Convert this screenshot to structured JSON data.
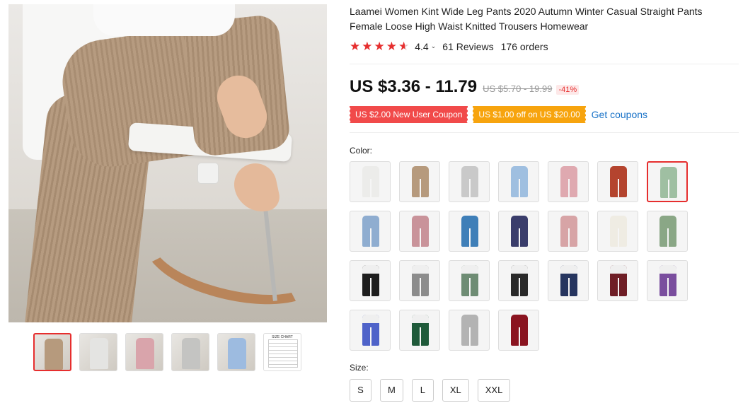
{
  "product": {
    "title": "Laamei Women Kint Wide Leg Pants 2020 Autumn Winter Casual Straight Pants Female Loose High Waist Knitted Trousers Homewear",
    "rating": "4.4",
    "rating_chevron": "⌄",
    "reviews": "61 Reviews",
    "orders": "176 orders"
  },
  "price": {
    "current": "US $3.36 - 11.79",
    "original": "US $5.70 - 19.99",
    "discount": "-41%"
  },
  "coupons": {
    "new_user": "US $2.00 New User Coupon",
    "store": "US $1.00 off on US $20.00",
    "get": "Get coupons"
  },
  "color_label": "Color:",
  "size_label": "Size:",
  "colors": [
    {
      "name": "white",
      "color": "#ececea"
    },
    {
      "name": "khaki",
      "color": "#b69a7d"
    },
    {
      "name": "light-gray",
      "color": "#c9c9c9"
    },
    {
      "name": "light-blue",
      "color": "#9fbfe0"
    },
    {
      "name": "pink",
      "color": "#dfa9b0"
    },
    {
      "name": "rust-red",
      "color": "#b4442e"
    },
    {
      "name": "green-print",
      "color": "#9fbfa2",
      "selected": true
    },
    {
      "name": "denim-blue",
      "color": "#8fadd0"
    },
    {
      "name": "dusty-pink",
      "color": "#c9939a"
    },
    {
      "name": "blue-print",
      "color": "#3f7fb8"
    },
    {
      "name": "navy-print",
      "color": "#3a3d6b"
    },
    {
      "name": "pink-print",
      "color": "#d7a4a6"
    },
    {
      "name": "cream",
      "color": "#efece3"
    },
    {
      "name": "sage-green",
      "color": "#8aa786"
    },
    {
      "name": "black",
      "color": "#1e1e1e"
    },
    {
      "name": "gray",
      "color": "#8c8c8c"
    },
    {
      "name": "green",
      "color": "#6e8c74"
    },
    {
      "name": "black-2",
      "color": "#2a2a2a"
    },
    {
      "name": "navy",
      "color": "#26355f"
    },
    {
      "name": "burgundy",
      "color": "#6f1e26"
    },
    {
      "name": "purple",
      "color": "#7a4e9e"
    },
    {
      "name": "royal-blue",
      "color": "#4f63c9"
    },
    {
      "name": "dark-green",
      "color": "#1f5a3a"
    },
    {
      "name": "silver-gray",
      "color": "#b3b3b3"
    },
    {
      "name": "wine-red",
      "color": "#8a1420"
    }
  ],
  "sizes": [
    "S",
    "M",
    "L",
    "XL",
    "XXL"
  ],
  "thumbnails": [
    {
      "name": "khaki",
      "color": "#b69a7d",
      "active": true
    },
    {
      "name": "white",
      "color": "#e4e4e2"
    },
    {
      "name": "pink",
      "color": "#d9a4ab"
    },
    {
      "name": "gray",
      "color": "#c4c4c2"
    },
    {
      "name": "blue",
      "color": "#9dbbe0"
    },
    {
      "name": "size-chart",
      "label": "SIZE CHART"
    }
  ],
  "accent_color": "#e62e2e"
}
